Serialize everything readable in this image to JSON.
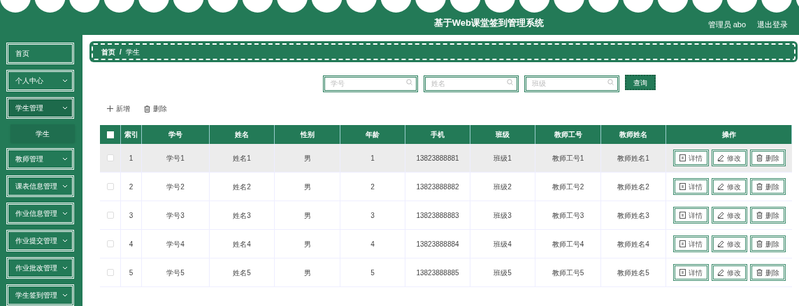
{
  "header": {
    "title": "基于Web课堂签到管理系统",
    "user": "管理员 abo",
    "logout": "退出登录"
  },
  "sidebar": {
    "items": [
      {
        "label": "首页",
        "kind": "link"
      },
      {
        "label": "个人中心",
        "kind": "menu",
        "expanded": false
      },
      {
        "label": "学生管理",
        "kind": "menu",
        "expanded": true,
        "children": [
          {
            "label": "学生",
            "selected": true
          }
        ]
      },
      {
        "label": "教师管理",
        "kind": "menu",
        "expanded": false
      },
      {
        "label": "课表信息管理",
        "kind": "menu",
        "expanded": false
      },
      {
        "label": "作业信息管理",
        "kind": "menu",
        "expanded": false
      },
      {
        "label": "作业提交管理",
        "kind": "menu",
        "expanded": false
      },
      {
        "label": "作业批改管理",
        "kind": "menu",
        "expanded": false
      },
      {
        "label": "学生签到管理",
        "kind": "menu",
        "expanded": false
      }
    ]
  },
  "breadcrumb": {
    "items": [
      "首页",
      "学生"
    ],
    "separator": "/"
  },
  "search": {
    "fields": [
      {
        "placeholder": "学号"
      },
      {
        "placeholder": "姓名"
      },
      {
        "placeholder": "班级"
      }
    ],
    "button": "查询"
  },
  "toolbar": [
    {
      "label": "新增",
      "kind": "add"
    },
    {
      "label": "删除",
      "kind": "delete"
    }
  ],
  "table": {
    "all_checked": false,
    "columns": [
      "索引",
      "学号",
      "姓名",
      "性别",
      "年龄",
      "手机",
      "班级",
      "教师工号",
      "教师姓名",
      "操作"
    ],
    "rows": [
      {
        "checked": false,
        "hovered": true,
        "cells": [
          "1",
          "学号1",
          "姓名1",
          "男",
          "1",
          "13823888881",
          "班级1",
          "教师工号1",
          "教师姓名1"
        ],
        "actions": [
          {
            "label": "详情",
            "kind": "detail"
          },
          {
            "label": "修改",
            "kind": "edit"
          },
          {
            "label": "删除",
            "kind": "delete"
          }
        ]
      },
      {
        "checked": false,
        "hovered": false,
        "cells": [
          "2",
          "学号2",
          "姓名2",
          "男",
          "2",
          "13823888882",
          "班级2",
          "教师工号2",
          "教师姓名2"
        ],
        "actions": [
          {
            "label": "详情",
            "kind": "detail"
          },
          {
            "label": "修改",
            "kind": "edit"
          },
          {
            "label": "删除",
            "kind": "delete"
          }
        ]
      },
      {
        "checked": false,
        "hovered": false,
        "cells": [
          "3",
          "学号3",
          "姓名3",
          "男",
          "3",
          "13823888883",
          "班级3",
          "教师工号3",
          "教师姓名3"
        ],
        "actions": [
          {
            "label": "详情",
            "kind": "detail"
          },
          {
            "label": "修改",
            "kind": "edit"
          },
          {
            "label": "删除",
            "kind": "delete"
          }
        ]
      },
      {
        "checked": false,
        "hovered": false,
        "cells": [
          "4",
          "学号4",
          "姓名4",
          "男",
          "4",
          "13823888884",
          "班级4",
          "教师工号4",
          "教师姓名4"
        ],
        "actions": [
          {
            "label": "详情",
            "kind": "detail"
          },
          {
            "label": "修改",
            "kind": "edit"
          },
          {
            "label": "删除",
            "kind": "delete"
          }
        ]
      },
      {
        "checked": false,
        "hovered": false,
        "cells": [
          "5",
          "学号5",
          "姓名5",
          "男",
          "5",
          "13823888885",
          "班级5",
          "教师工号5",
          "教师姓名5"
        ],
        "actions": [
          {
            "label": "详情",
            "kind": "detail"
          },
          {
            "label": "修改",
            "kind": "edit"
          },
          {
            "label": "删除",
            "kind": "delete"
          }
        ]
      }
    ]
  }
}
